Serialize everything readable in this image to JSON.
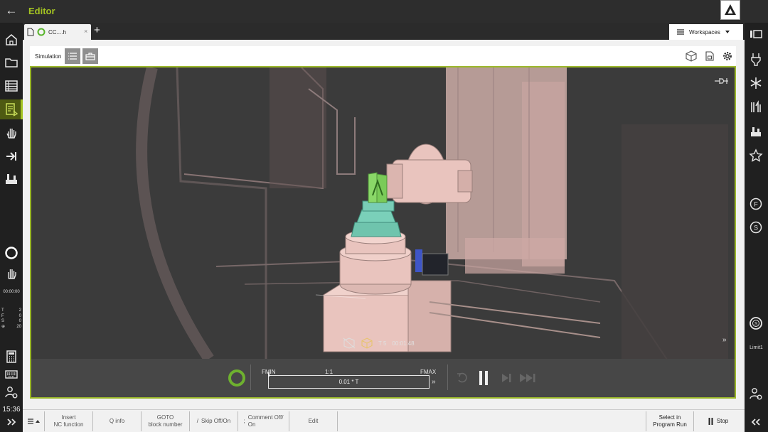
{
  "header": {
    "back_icon": "arrow-left-icon",
    "title": "Editor",
    "logo_icon": "heidenhain-logo-icon"
  },
  "tab": {
    "label": "CC....h",
    "close": "×",
    "add": "+"
  },
  "workspaces": {
    "label": "Workspaces"
  },
  "simulation": {
    "label": "Simulation"
  },
  "left_status": {
    "elapsed": "00:00:00",
    "rows": [
      {
        "k": "T",
        "v": "2"
      },
      {
        "k": "F",
        "v": "0"
      },
      {
        "k": "S",
        "v": "0"
      },
      {
        "k": "⊕",
        "v": "20"
      }
    ],
    "clock": "15:36"
  },
  "right_status": {
    "limit": "Limit1"
  },
  "viewport": {
    "tool_label": "T 5",
    "time": "00:01:48"
  },
  "feed": {
    "fmin": "FMIN",
    "ratio": "1:1",
    "fmax": "FMAX",
    "value": "0.01 * T"
  },
  "softkeys": {
    "insert_nc": "Insert\nNC function",
    "q_info": "Q info",
    "goto": "GOTO\nblock number",
    "skip_prefix": "/",
    "skip": "Skip Off/On",
    "comment_prefix": ";",
    "comment": "Comment Off/\nOn",
    "edit": "Edit",
    "select_program_run": "Select in\nProgram Run",
    "stop": "Stop"
  },
  "colors": {
    "accent": "#a4c322",
    "machine": "#e9c4be",
    "fixture": "#6fc4ad"
  }
}
